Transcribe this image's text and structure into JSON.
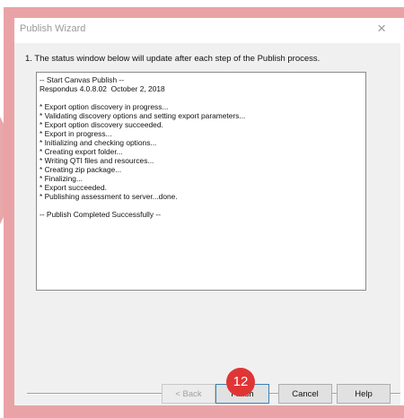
{
  "window": {
    "title": "Publish Wizard",
    "close_glyph": "×"
  },
  "instruction": "1.  The status window below will update after each step of the Publish process.",
  "status_lines": [
    "-- Start Canvas Publish --",
    "Respondus 4.0.8.02  October 2, 2018",
    "",
    "* Export option discovery in progress...",
    "* Validating discovery options and setting export parameters...",
    "* Export option discovery succeeded.",
    "* Export in progress...",
    "* Initializing and checking options...",
    "* Creating export folder...",
    "* Writing QTI files and resources...",
    "* Creating zip package...",
    "* Finalizing...",
    "* Export succeeded.",
    "* Publishing assessment to server...done.",
    "",
    "-- Publish Completed Successfully --"
  ],
  "buttons": {
    "back": "< Back",
    "finish": "Finish",
    "cancel": "Cancel",
    "help": "Help"
  },
  "step_badge": "12",
  "colors": {
    "highlight_frame": "#e9a3a6",
    "badge": "#e03535"
  }
}
